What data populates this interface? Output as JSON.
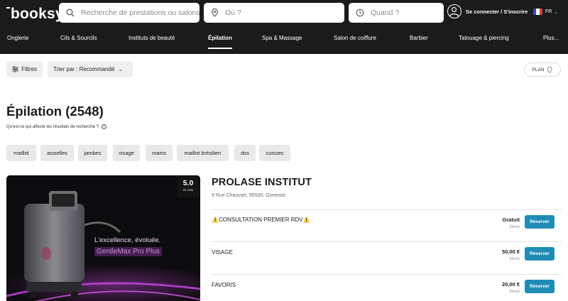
{
  "header": {
    "logo": "booksy",
    "search_placeholder": "Recherche de prestations ou salons",
    "where_placeholder": "Où ?",
    "when_placeholder": "Quand ?",
    "login_label": "Se connecter / S'inscrire",
    "language": "FR"
  },
  "nav": {
    "items": [
      "Onglerie",
      "Cils & Sourcils",
      "Instituts de beauté",
      "Épilation",
      "Spa & Massage",
      "Salon de coiffure",
      "Barbier",
      "Tatouage & piercing",
      "Plus..."
    ],
    "active": "Épilation"
  },
  "filters": {
    "filters_label": "Filtres",
    "sort_label": "Trier par : Recommandé",
    "map_label": "PLAN"
  },
  "results": {
    "title": "Épilation (2548)",
    "question": "Qu'est-ce qui affecte les résultats de recherche ?"
  },
  "tags": [
    "maillot",
    "aisselles",
    "jambes",
    "visage",
    "mains",
    "maillot brésilien",
    "dos",
    "cuisses"
  ],
  "listing": {
    "rating": "5.0",
    "reviews": "61 avis",
    "name": "PROLASE INSTITUT",
    "address": "9 Rue Chauvart, 95500, Gonesse",
    "photo_caption_1": "L'excellence, évoluée.",
    "photo_caption_2": "GentleMax Pro Plus",
    "book_label": "Réserver",
    "services": [
      {
        "name": "⚠️CONSULTATION PREMIER RDV⚠️",
        "price": "Gratuit",
        "duration": "15min"
      },
      {
        "name": "VISAGE",
        "price": "50,00 €",
        "duration": "10min"
      },
      {
        "name": "FAVORIS",
        "price": "20,00 €",
        "duration": "10min"
      }
    ]
  },
  "colors": {
    "header_bg": "#1b1b1c",
    "accent": "#1d8db5",
    "photo_glow": "#b83fd6"
  }
}
